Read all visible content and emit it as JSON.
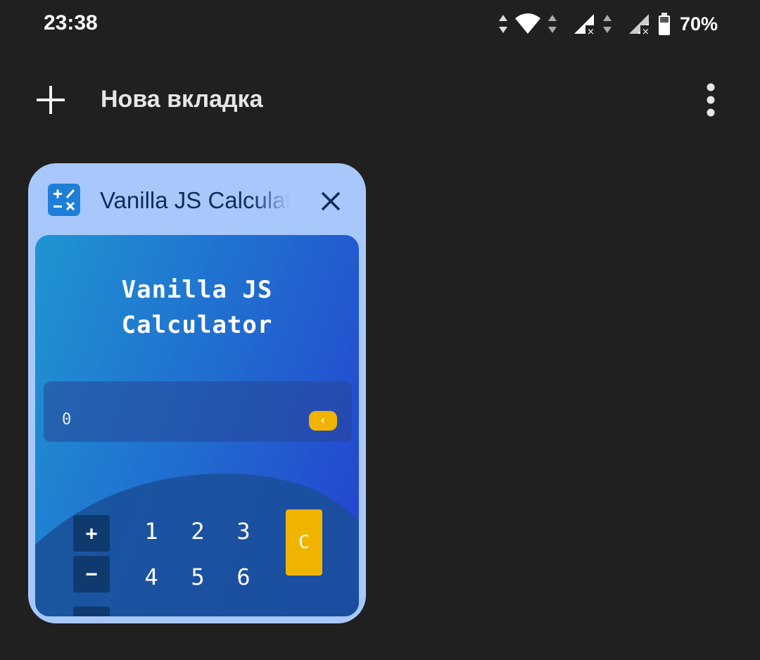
{
  "status": {
    "time": "23:38",
    "battery": "70%",
    "icons": [
      "data-arrows-icon",
      "wifi-icon",
      "signal-no-service-icon",
      "signal-no-service-icon",
      "battery-icon"
    ]
  },
  "toolbar": {
    "new_tab_label": "Нова вкладка",
    "new_tab_icon": "plus-icon",
    "menu_icon": "more-vertical-icon"
  },
  "tab": {
    "title": "Vanilla JS Calculator",
    "favicon": "calculator-icon",
    "close_icon": "close-icon",
    "accent": "#a8c8fb"
  },
  "thumbnail": {
    "title_line1": "Vanilla JS",
    "title_line2": "Calculator",
    "display_value": "0",
    "backspace_label": "‹",
    "operators": [
      "+",
      "−"
    ],
    "digits_row1": [
      "1",
      "2",
      "3"
    ],
    "digits_row2": [
      "4",
      "5",
      "6"
    ],
    "clear_label": "C",
    "accent": "#f0b400"
  }
}
